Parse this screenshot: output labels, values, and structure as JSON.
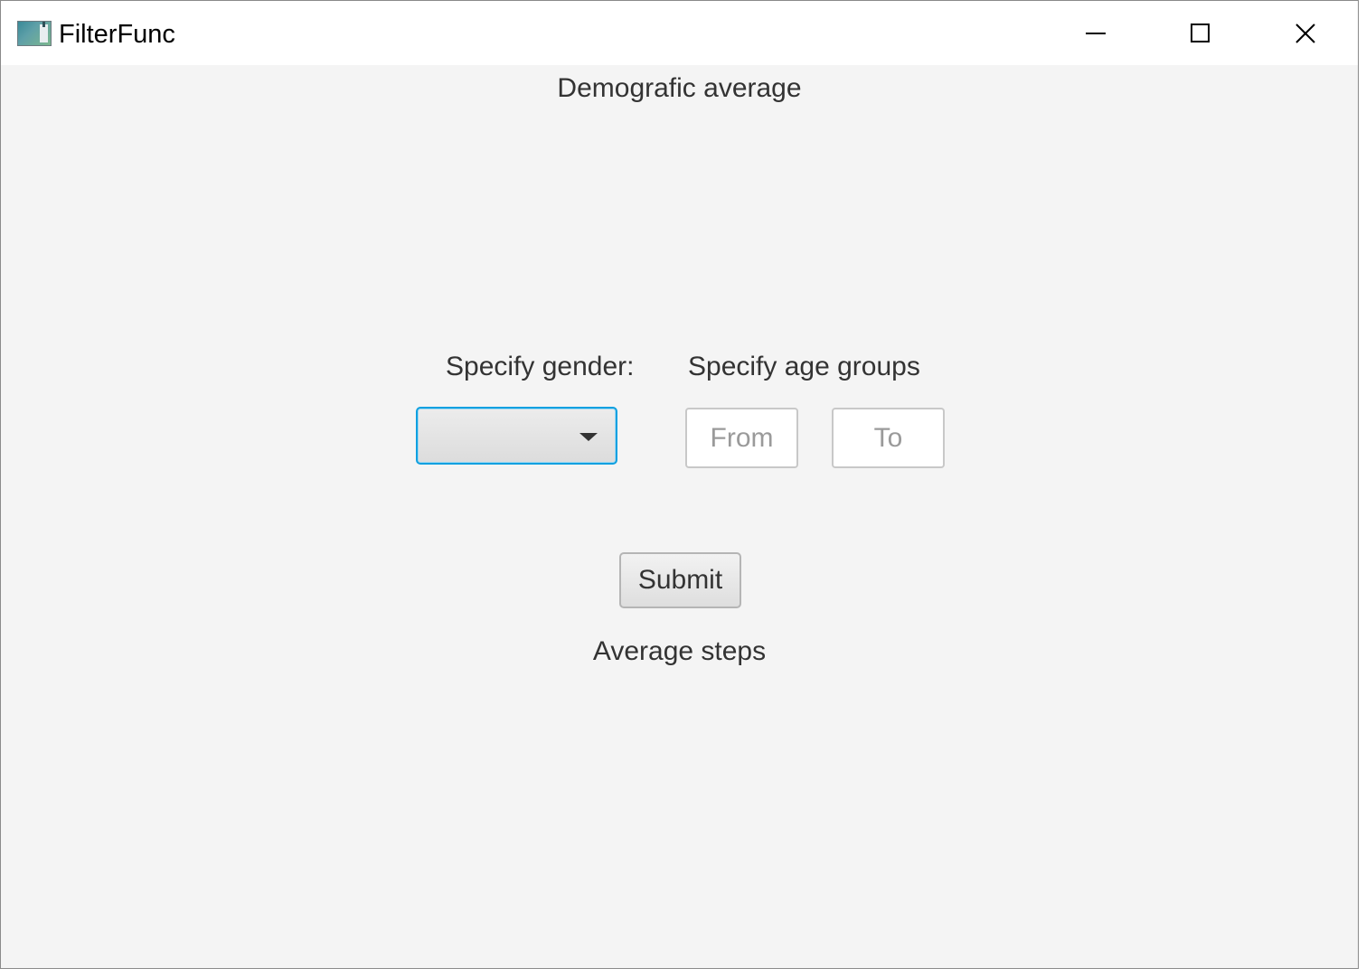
{
  "window": {
    "title": "FilterFunc",
    "icon": "app-window-icon",
    "controls": {
      "minimize": "minimize-icon",
      "maximize": "maximize-icon",
      "close": "close-icon"
    }
  },
  "main": {
    "heading": "Demografic average",
    "gender_label": "Specify gender:",
    "gender_select": {
      "value": ""
    },
    "age_label": "Specify age groups",
    "age_from": {
      "value": "",
      "placeholder": "From"
    },
    "age_to": {
      "value": "",
      "placeholder": "To"
    },
    "submit_label": "Submit",
    "result_label": "Average steps"
  },
  "colors": {
    "background": "#f4f4f4",
    "focus_accent": "#0fa0e0",
    "text": "#333333"
  }
}
